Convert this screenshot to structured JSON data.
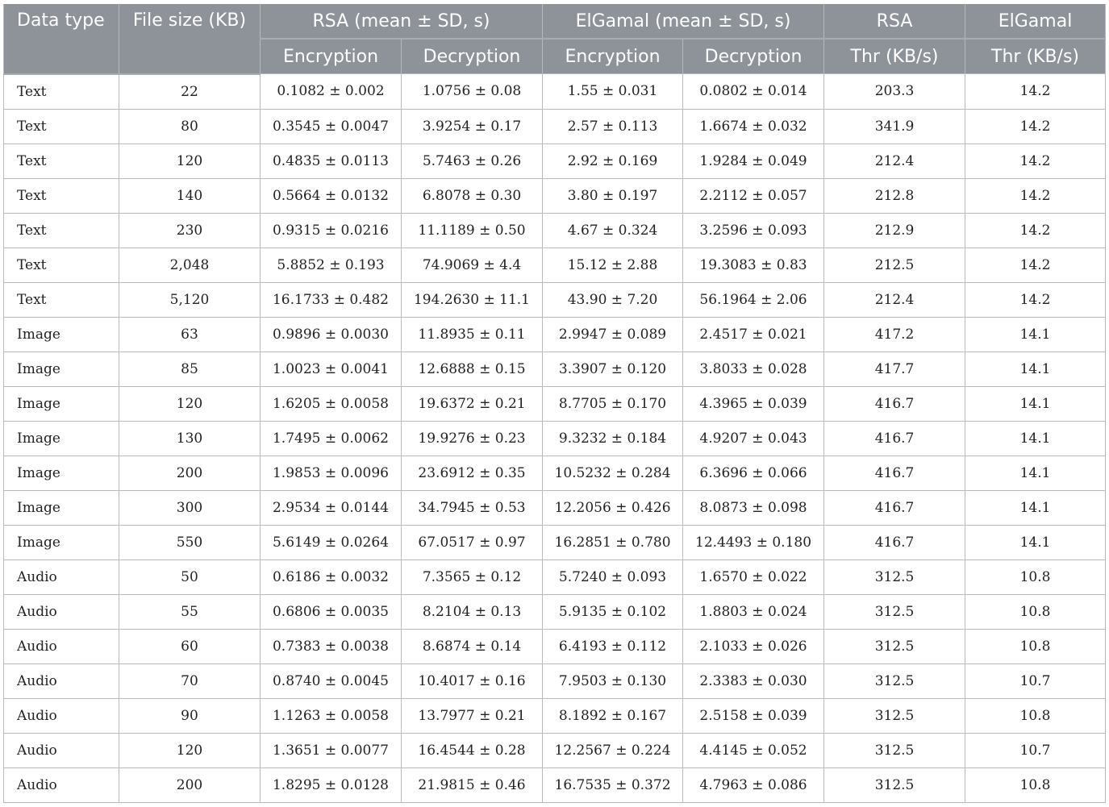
{
  "header": {
    "data_type": "Data type",
    "file_size": "File size (KB)",
    "rsa_group": "RSA (mean ± SD, s)",
    "elgamal_group": "ElGamal (mean ± SD, s)",
    "rsa_thr_line1": "RSA",
    "rsa_thr_line2": "Thr (KB/s)",
    "elgamal_thr_line1": "ElGamal",
    "elgamal_thr_line2": "Thr (KB/s)",
    "rsa_enc": "Encryption",
    "rsa_dec": "Decryption",
    "elg_enc": "Encryption",
    "elg_dec": "Decryption"
  },
  "rows": [
    [
      "Text",
      "22",
      "0.1082 ± 0.002",
      "1.0756 ± 0.08",
      "1.55 ± 0.031",
      "0.0802 ± 0.014",
      "203.3",
      "14.2"
    ],
    [
      "Text",
      "80",
      "0.3545 ± 0.0047",
      "3.9254 ± 0.17",
      "2.57 ± 0.113",
      "1.6674 ± 0.032",
      "341.9",
      "14.2"
    ],
    [
      "Text",
      "120",
      "0.4835 ± 0.0113",
      "5.7463 ± 0.26",
      "2.92 ± 0.169",
      "1.9284 ± 0.049",
      "212.4",
      "14.2"
    ],
    [
      "Text",
      "140",
      "0.5664 ± 0.0132",
      "6.8078 ± 0.30",
      "3.80 ± 0.197",
      "2.2112 ± 0.057",
      "212.8",
      "14.2"
    ],
    [
      "Text",
      "230",
      "0.9315 ± 0.0216",
      "11.1189 ± 0.50",
      "4.67 ± 0.324",
      "3.2596 ± 0.093",
      "212.9",
      "14.2"
    ],
    [
      "Text",
      "2,048",
      "5.8852 ± 0.193",
      "74.9069 ± 4.4",
      "15.12 ± 2.88",
      "19.3083 ± 0.83",
      "212.5",
      "14.2"
    ],
    [
      "Text",
      "5,120",
      "16.1733 ± 0.482",
      "194.2630 ± 11.1",
      "43.90 ± 7.20",
      "56.1964 ± 2.06",
      "212.4",
      "14.2"
    ],
    [
      "Image",
      "63",
      "0.9896 ± 0.0030",
      "11.8935 ± 0.11",
      "2.9947 ± 0.089",
      "2.4517 ± 0.021",
      "417.2",
      "14.1"
    ],
    [
      "Image",
      "85",
      "1.0023 ± 0.0041",
      "12.6888 ± 0.15",
      "3.3907 ± 0.120",
      "3.8033 ± 0.028",
      "417.7",
      "14.1"
    ],
    [
      "Image",
      "120",
      "1.6205 ± 0.0058",
      "19.6372 ± 0.21",
      "8.7705 ± 0.170",
      "4.3965 ± 0.039",
      "416.7",
      "14.1"
    ],
    [
      "Image",
      "130",
      "1.7495 ± 0.0062",
      "19.9276 ± 0.23",
      "9.3232 ± 0.184",
      "4.9207 ± 0.043",
      "416.7",
      "14.1"
    ],
    [
      "Image",
      "200",
      "1.9853 ± 0.0096",
      "23.6912 ± 0.35",
      "10.5232 ± 0.284",
      "6.3696 ± 0.066",
      "416.7",
      "14.1"
    ],
    [
      "Image",
      "300",
      "2.9534 ± 0.0144",
      "34.7945 ± 0.53",
      "12.2056 ± 0.426",
      "8.0873 ± 0.098",
      "416.7",
      "14.1"
    ],
    [
      "Image",
      "550",
      "5.6149 ± 0.0264",
      "67.0517 ± 0.97",
      "16.2851 ± 0.780",
      "12.4493 ± 0.180",
      "416.7",
      "14.1"
    ],
    [
      "Audio",
      "50",
      "0.6186 ± 0.0032",
      "7.3565 ± 0.12",
      "5.7240 ± 0.093",
      "1.6570 ± 0.022",
      "312.5",
      "10.8"
    ],
    [
      "Audio",
      "55",
      "0.6806 ± 0.0035",
      "8.2104 ± 0.13",
      "5.9135 ± 0.102",
      "1.8803 ± 0.024",
      "312.5",
      "10.8"
    ],
    [
      "Audio",
      "60",
      "0.7383 ± 0.0038",
      "8.6874 ± 0.14",
      "6.4193 ± 0.112",
      "2.1033 ± 0.026",
      "312.5",
      "10.8"
    ],
    [
      "Audio",
      "70",
      "0.8740 ± 0.0045",
      "10.4017 ± 0.16",
      "7.9503 ± 0.130",
      "2.3383 ± 0.030",
      "312.5",
      "10.7"
    ],
    [
      "Audio",
      "90",
      "1.1263 ± 0.0058",
      "13.7977 ± 0.21",
      "8.1892 ± 0.167",
      "2.5158 ± 0.039",
      "312.5",
      "10.8"
    ],
    [
      "Audio",
      "120",
      "1.3651 ± 0.0077",
      "16.4544 ± 0.28",
      "12.2567 ± 0.224",
      "4.4145 ± 0.052",
      "312.5",
      "10.7"
    ],
    [
      "Audio",
      "200",
      "1.8295 ± 0.0128",
      "21.9815 ± 0.46",
      "16.7535 ± 0.372",
      "4.7963 ± 0.086",
      "312.5",
      "10.8"
    ]
  ]
}
